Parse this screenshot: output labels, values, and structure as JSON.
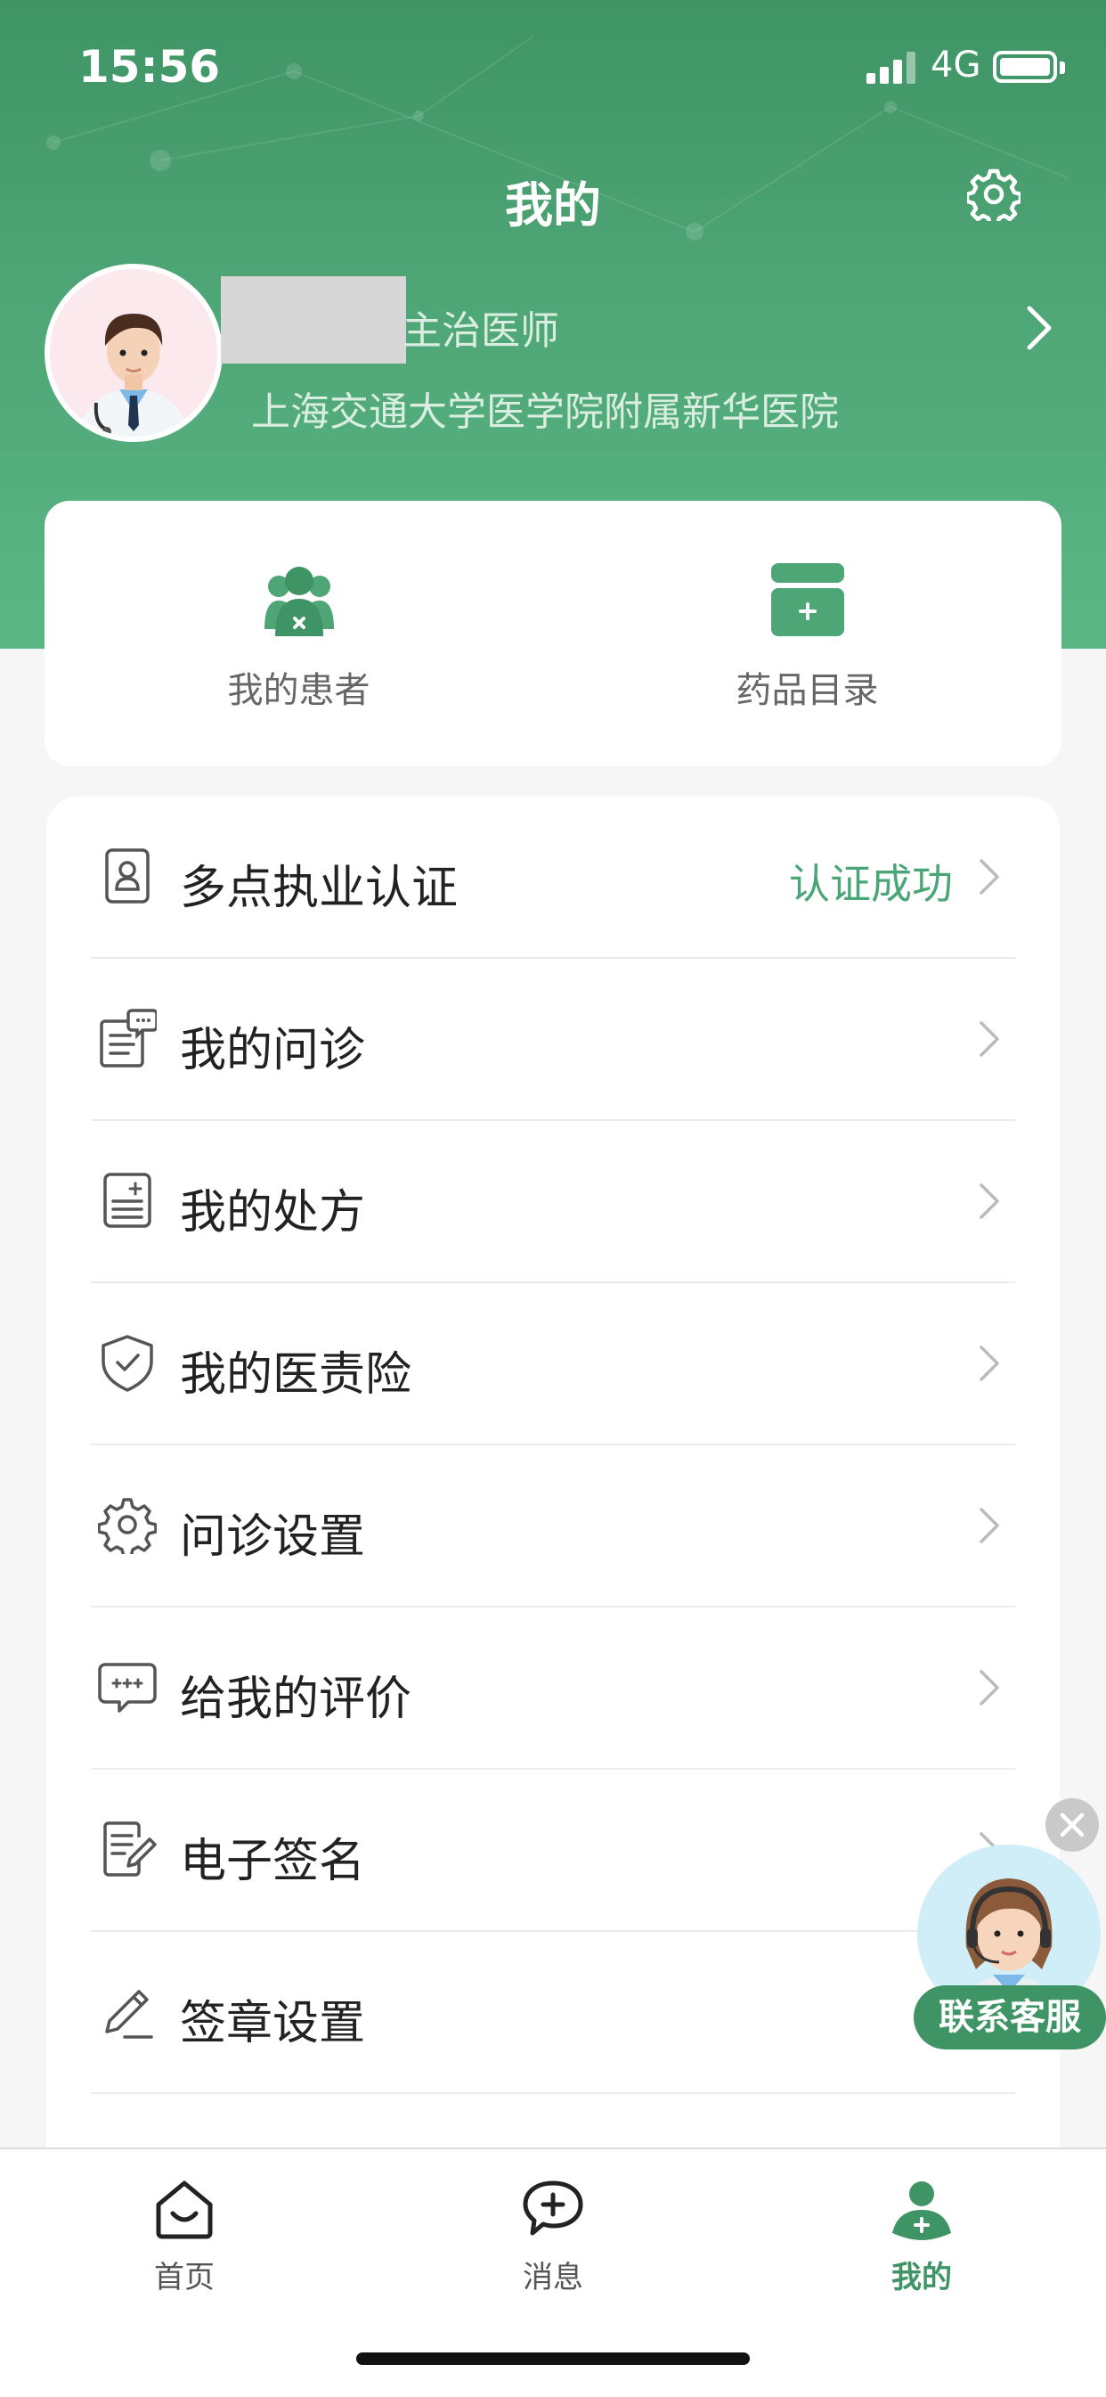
{
  "status_bar": {
    "time": "15:56",
    "network": "4G"
  },
  "header": {
    "title": "我的"
  },
  "profile": {
    "title": "主治医师",
    "hospital": "上海交通大学医学院附属新华医院"
  },
  "quick_actions": [
    {
      "label": "我的患者",
      "icon": "patients-icon"
    },
    {
      "label": "药品目录",
      "icon": "medicine-box-icon"
    }
  ],
  "menu": [
    {
      "label": "多点执业认证",
      "status": "认证成功",
      "icon": "id-card-icon"
    },
    {
      "label": "我的问诊",
      "status": "",
      "icon": "consultation-icon"
    },
    {
      "label": "我的处方",
      "status": "",
      "icon": "prescription-icon"
    },
    {
      "label": "我的医责险",
      "status": "",
      "icon": "shield-check-icon"
    },
    {
      "label": "问诊设置",
      "status": "",
      "icon": "gear-icon"
    },
    {
      "label": "给我的评价",
      "status": "",
      "icon": "comment-icon"
    },
    {
      "label": "电子签名",
      "status": "",
      "icon": "signature-icon"
    },
    {
      "label": "签章设置",
      "status": "",
      "icon": "pen-icon"
    }
  ],
  "customer_service": {
    "label": "联系客服"
  },
  "tabbar": [
    {
      "label": "首页",
      "icon": "home-icon",
      "active": false
    },
    {
      "label": "消息",
      "icon": "message-icon",
      "active": false
    },
    {
      "label": "我的",
      "icon": "doctor-icon",
      "active": true
    }
  ],
  "colors": {
    "brand_green": "#4ea575",
    "status_green": "#4aa676",
    "active_tab": "#3f9465"
  }
}
